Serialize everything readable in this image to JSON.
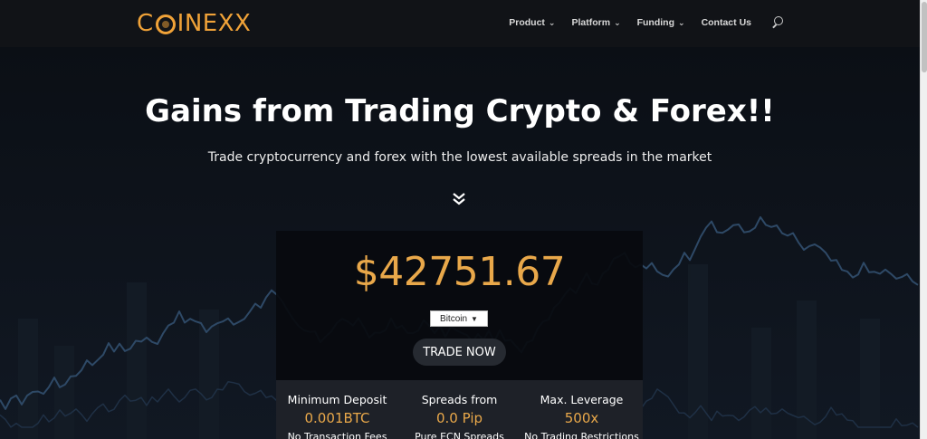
{
  "brand": {
    "logo_text_left": "C",
    "logo_text_right": "INEXX",
    "accent": "#f0a238"
  },
  "nav": {
    "items": [
      {
        "label": "Product",
        "has_dropdown": true
      },
      {
        "label": "Platform",
        "has_dropdown": true
      },
      {
        "label": "Funding",
        "has_dropdown": true
      },
      {
        "label": "Contact Us",
        "has_dropdown": false
      }
    ],
    "search_icon": "search-icon"
  },
  "hero": {
    "title": "Gains from Trading Crypto & Forex!!",
    "subtitle": "Trade cryptocurrency and forex with the lowest available spreads in the market",
    "scroll_icon": "double-chevron-down-icon"
  },
  "ticker": {
    "price": "$42751.67",
    "asset_selected": "Bitcoin",
    "price_color": "#e9a84a",
    "cta_label": "TRADE NOW"
  },
  "stats": [
    {
      "label": "Minimum Deposit",
      "value": "0.001BTC",
      "note": "No Transaction Fees"
    },
    {
      "label": "Spreads from",
      "value": "0.0 Pip",
      "note": "Pure ECN Spreads"
    },
    {
      "label": "Max. Leverage",
      "value": "500x",
      "note": "No Trading Restrictions"
    }
  ]
}
